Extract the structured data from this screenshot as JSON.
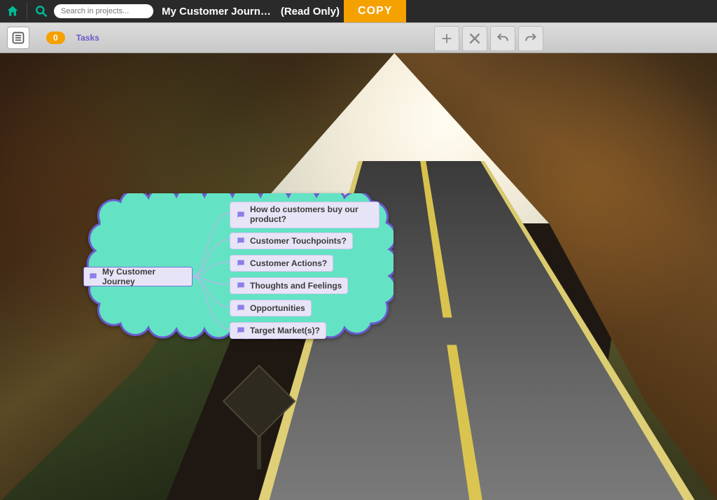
{
  "topbar": {
    "search_placeholder": "Search in projects...",
    "project_title": "My Customer Journ…",
    "readonly_label": "(Read Only)",
    "copy_label": "COPY"
  },
  "toolbar": {
    "task_count": "0",
    "tasks_label": "Tasks"
  },
  "mindmap": {
    "root": "My Customer Journey",
    "branches": [
      "How do customers buy our product?",
      "Customer Touchpoints?",
      "Customer Actions?",
      "Thoughts and Feelings",
      "Opportunities",
      "Target Market(s)?"
    ]
  },
  "colors": {
    "accent_orange": "#f5a100",
    "accent_teal": "#00b894",
    "cloud_fill": "#63e3c3",
    "cloud_stroke": "#6a5acd",
    "node_fill": "#e8e4f7",
    "node_stroke": "#7a6ee0"
  }
}
